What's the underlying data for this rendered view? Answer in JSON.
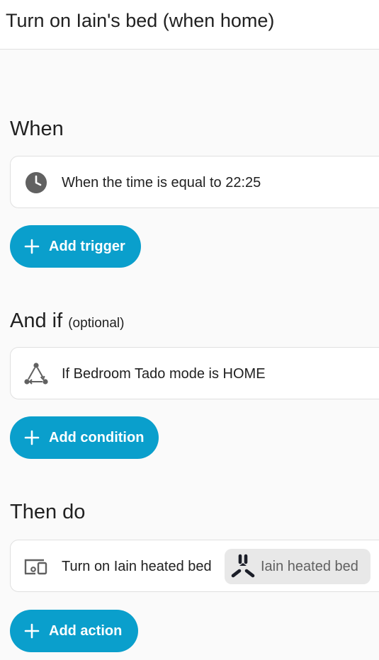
{
  "header": {
    "title": "Turn on Iain's bed (when home)"
  },
  "triggers": {
    "heading": "When",
    "items": [
      {
        "icon": "clock-icon",
        "text": "When the time is equal to 22:25"
      }
    ],
    "add_label": "Add trigger"
  },
  "conditions": {
    "heading": "And if",
    "optional_label": "(optional)",
    "items": [
      {
        "icon": "state-condition-icon",
        "text": "If Bedroom Tado mode is HOME"
      }
    ],
    "add_label": "Add condition"
  },
  "actions": {
    "heading": "Then do",
    "items": [
      {
        "icon": "device-icon",
        "text": "Turn on Iain heated bed",
        "target_chip": {
          "icon": "smart-plug-logo-icon",
          "label": "Iain heated bed"
        }
      }
    ],
    "add_label": "Add action"
  },
  "colors": {
    "accent": "#0a9fcc",
    "background": "#fafafa",
    "card": "#ffffff",
    "icon": "#616161",
    "chip": "#e8e8e8"
  }
}
